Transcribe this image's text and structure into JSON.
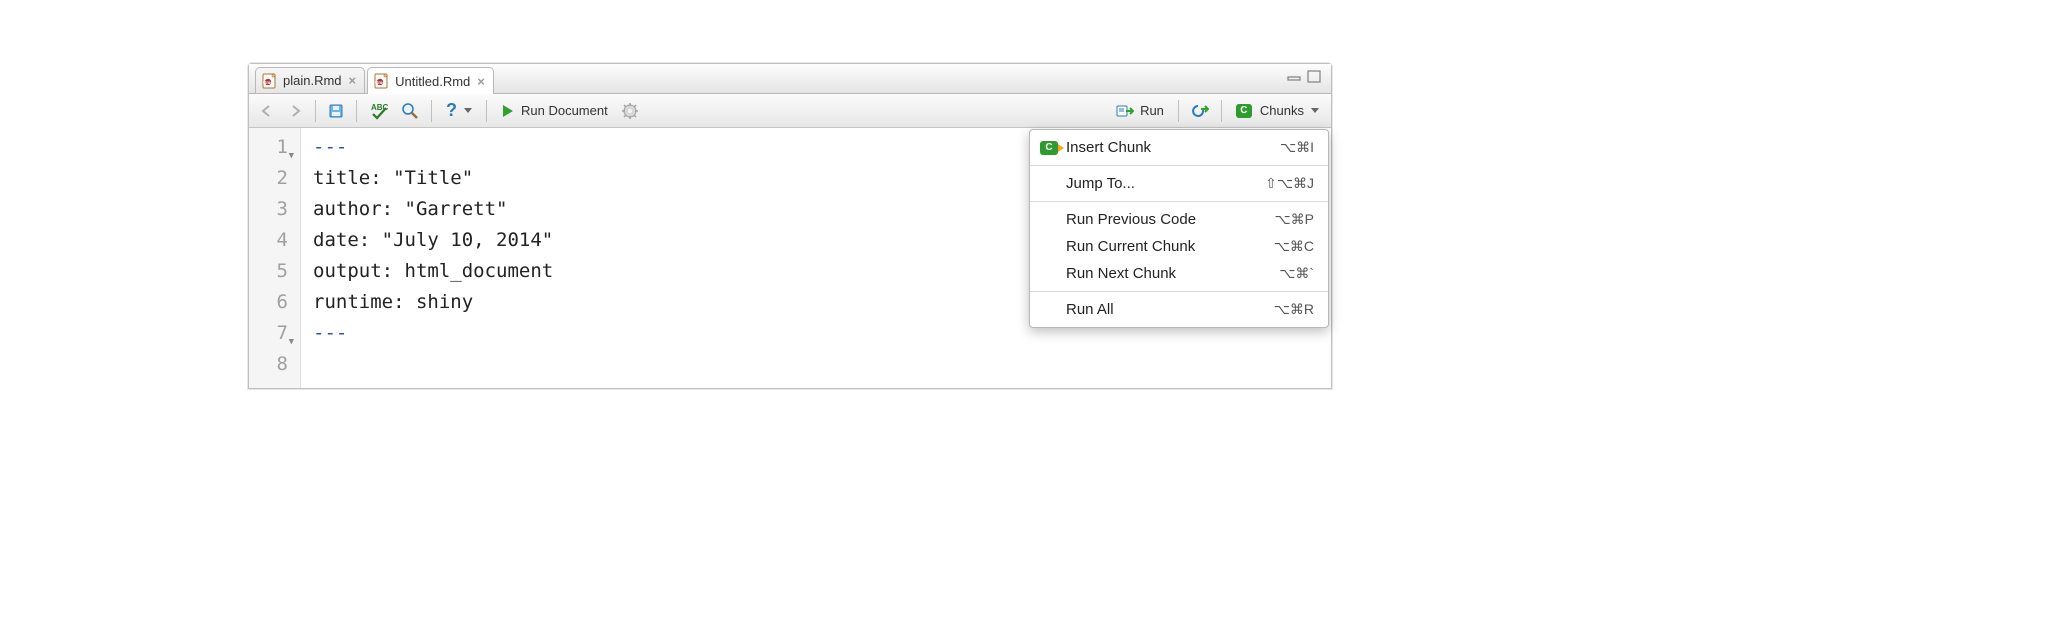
{
  "tabs": [
    {
      "label": "plain.Rmd",
      "active": false
    },
    {
      "label": "Untitled.Rmd",
      "active": true
    }
  ],
  "toolbar": {
    "run_document_label": "Run Document",
    "run_label": "Run",
    "chunks_label": "Chunks"
  },
  "editor": {
    "lines": [
      {
        "num": "1",
        "fold": true,
        "text": "---",
        "cls": "triple"
      },
      {
        "num": "2",
        "fold": false,
        "text": "title: \"Title\""
      },
      {
        "num": "3",
        "fold": false,
        "text": "author: \"Garrett\""
      },
      {
        "num": "4",
        "fold": false,
        "text": "date: \"July 10, 2014\""
      },
      {
        "num": "5",
        "fold": false,
        "text": "output: html_document"
      },
      {
        "num": "6",
        "fold": false,
        "text": "runtime: shiny"
      },
      {
        "num": "7",
        "fold": true,
        "text": "---",
        "cls": "triple"
      },
      {
        "num": "8",
        "fold": false,
        "text": ""
      }
    ]
  },
  "menu": {
    "items": [
      {
        "label": "Insert Chunk",
        "shortcut": "⌥⌘I",
        "icon": true
      },
      {
        "sep": true
      },
      {
        "label": "Jump To...",
        "shortcut": "⇧⌥⌘J"
      },
      {
        "sep": true
      },
      {
        "label": "Run Previous Code",
        "shortcut": "⌥⌘P"
      },
      {
        "label": "Run Current Chunk",
        "shortcut": "⌥⌘C"
      },
      {
        "label": "Run Next Chunk",
        "shortcut": "⌥⌘`"
      },
      {
        "sep": true
      },
      {
        "label": "Run All",
        "shortcut": "⌥⌘R"
      }
    ]
  }
}
